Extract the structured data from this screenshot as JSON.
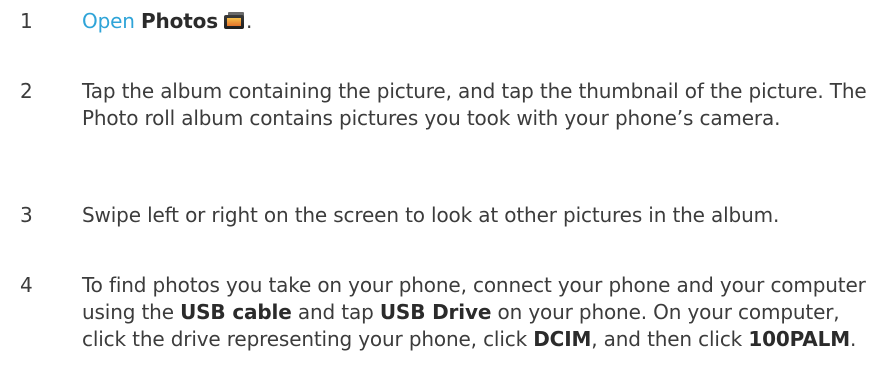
{
  "steps": [
    {
      "number": "1",
      "open_link": "Open",
      "app_name": "Photos",
      "icon": "photos-app-icon",
      "end": "."
    },
    {
      "number": "2",
      "text": "Tap the album containing the picture, and tap the thumbnail of the picture. The Photo roll album contains pictures you took with your phone’s camera."
    },
    {
      "number": "3",
      "text": "Swipe left or right on the screen to look at other pictures in the album."
    },
    {
      "number": "4",
      "t1": "To find photos you take on your phone, connect your phone and your computer using the",
      "usb_cable": "USB cable",
      "t2": "and tap",
      "usb_drive": "USB Drive",
      "t3": "on your phone. On your computer, click the drive representing your phone, click",
      "dcim": "DCIM",
      "t4": ", and then click",
      "folder": "100PALM",
      "t5": "."
    }
  ],
  "colors": {
    "link": "#2fa4d8",
    "text": "#3c3c3c"
  }
}
